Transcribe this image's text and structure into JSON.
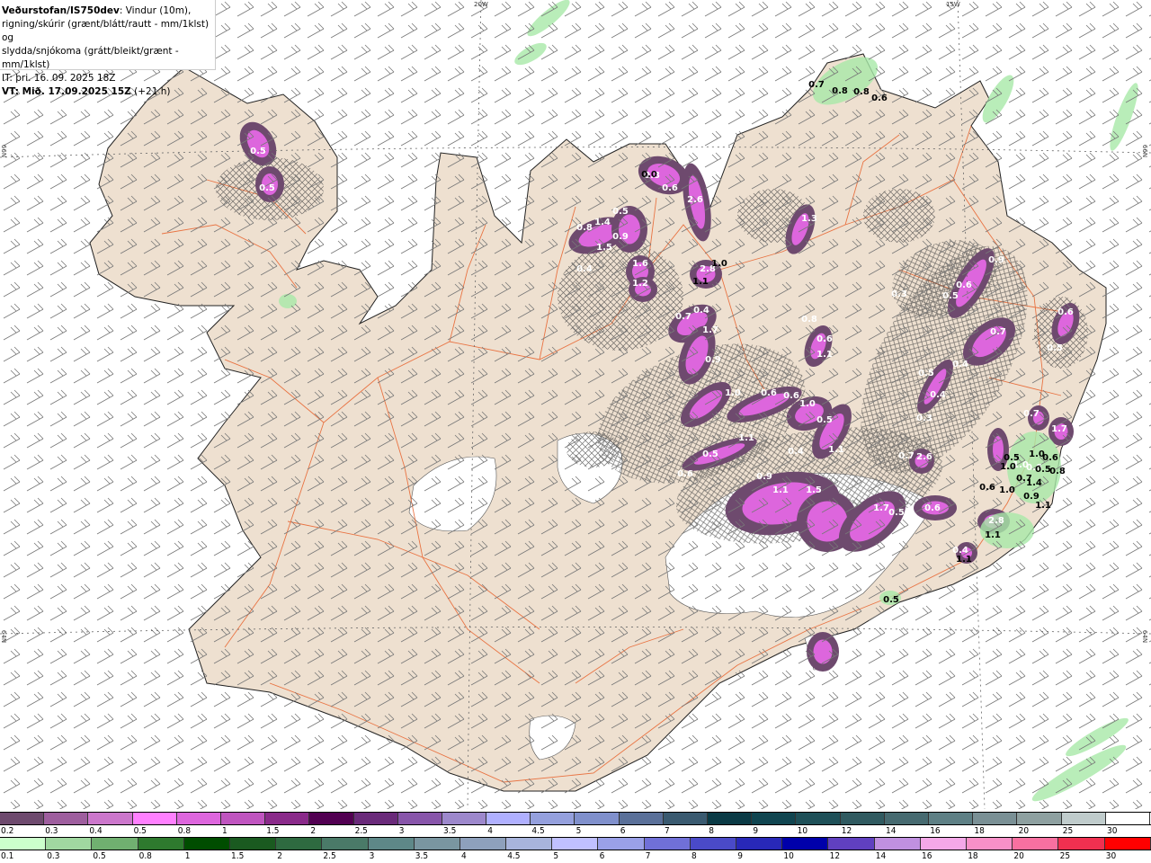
{
  "header": {
    "source": "Veðurstofan/IS750dev",
    "line1_rest": ": Vindur (10m),",
    "line2": "rigning/skúrir (grænt/blátt/rautt - mm/1klst) og",
    "line3": "slydda/snjókoma (grátt/bleikt/grænt - mm/1klst)",
    "issue_time": "IT: þri. 16. 09. 2025 18Z",
    "valid_time_bold": "VT: Mið. 17.09.2025 15Z",
    "valid_time_offset": " (+21 h)"
  },
  "grid_labels": {
    "lon_20w": "20W",
    "lon_15w": "15W",
    "lat_66n_left": "66N",
    "lat_64n_left": "64N",
    "lat_66n_right": "66N",
    "lat_64n_right": "64N"
  },
  "colors": {
    "land": "#eee0d0",
    "sea": "#ffffff",
    "roads": "#e8602a",
    "snow_purple": "#cc66dd",
    "rain_green": "#a8e8a8",
    "glacier": "#ffffff"
  },
  "map_labels": {
    "snow": [
      "0.5",
      "0.5",
      "0.8",
      "1.4",
      "0.5",
      "0.9",
      "1.5",
      "0.4",
      "1.6",
      "1.2",
      "0.8",
      "0.6",
      "2.6",
      "2.8",
      "1.3",
      "0.7",
      "0.4",
      "1.7",
      "0.9",
      "1.0",
      "0.6",
      "0.6",
      "1.0",
      "0.5",
      "0.8",
      "0.6",
      "1.1",
      "1.1",
      "0.4",
      "1.1",
      "0.5",
      "0.6",
      "0.9",
      "1.1",
      "1.5",
      "1.7",
      "0.5",
      "0.6",
      "0.9",
      "0.6",
      "0.5",
      "0.7",
      "0.5",
      "0.4",
      "0.4",
      "0.3",
      "2.6",
      "0.7",
      "0.6",
      "0.5",
      "1.7",
      "0.7",
      "1.0",
      "0.6",
      "2.8",
      "0.4",
      "0.3"
    ],
    "rain": [
      "0.7",
      "0.8",
      "0.8",
      "0.6",
      "0.0",
      "1.0",
      "1.1",
      "0.5",
      "1.0",
      "0.6",
      "0.5",
      "0.8",
      "1.0",
      "0.7",
      "1.4",
      "0.6",
      "1.0",
      "0.9",
      "1.1",
      "1.1",
      "1.1",
      "0.5"
    ]
  },
  "legend_snow": {
    "labels": [
      "0.2",
      "0.3",
      "0.4",
      "0.5",
      "0.8",
      "1",
      "1.5",
      "2",
      "2.5",
      "3",
      "3.5",
      "4",
      "4.5",
      "5",
      "6",
      "7",
      "8",
      "9",
      "10",
      "12",
      "14",
      "16",
      "18",
      "20",
      "25",
      "30"
    ],
    "colors": [
      "#6e4a6e",
      "#9e5e9e",
      "#cc77cc",
      "#ff80ff",
      "#dd66dd",
      "#c055c0",
      "#8a2a8a",
      "#520052",
      "#6a2a7a",
      "#8855aa",
      "#9d88cc",
      "#b0b0ff",
      "#95a0dd",
      "#8090cc",
      "#5a7099",
      "#3a5a70",
      "#0a3a45",
      "#104550",
      "#1e5058",
      "#305a60",
      "#466a70",
      "#5e8085",
      "#7a9095",
      "#8ea0a0",
      "#c0cccc",
      "#ffffff"
    ]
  },
  "legend_rain": {
    "labels": [
      "0.1",
      "0.3",
      "0.5",
      "0.8",
      "1",
      "1.5",
      "2",
      "2.5",
      "3",
      "3.5",
      "4",
      "4.5",
      "5",
      "6",
      "7",
      "8",
      "9",
      "10",
      "12",
      "14",
      "16",
      "18",
      "20",
      "25",
      "30"
    ],
    "colors": [
      "#ccffcc",
      "#a0d8a0",
      "#70b070",
      "#2e7a2e",
      "#004d00",
      "#1a5a20",
      "#2e6a40",
      "#4a7a68",
      "#5e8888",
      "#7a96a0",
      "#8ea0bc",
      "#a8b4dc",
      "#c0c0ff",
      "#9aa0e8",
      "#7070d8",
      "#4a4ac8",
      "#2828b8",
      "#0000aa",
      "#6040c0",
      "#c090e0",
      "#f4a8e8",
      "#f890c8",
      "#f870a0",
      "#f03050",
      "#ff0000"
    ]
  }
}
